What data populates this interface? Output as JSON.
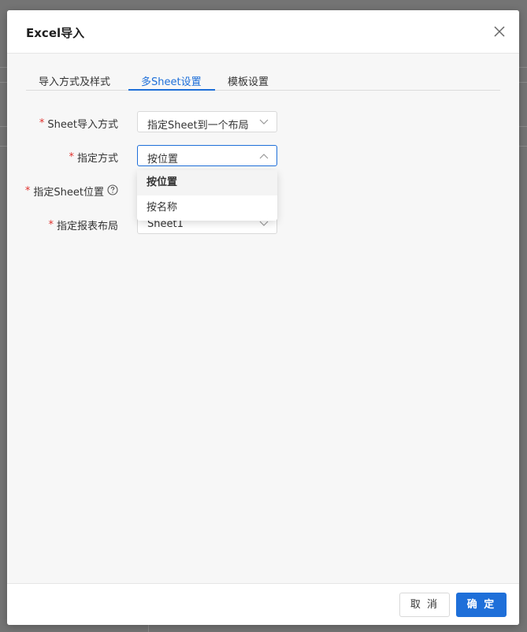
{
  "dialog": {
    "title": "Excel导入",
    "close_icon": "close-icon"
  },
  "tabs": [
    {
      "label": "导入方式及样式",
      "active": false
    },
    {
      "label": "多Sheet设置",
      "active": true
    },
    {
      "label": "模板设置",
      "active": false
    }
  ],
  "form": {
    "required_mark": "*",
    "sheet_import_mode": {
      "label": "Sheet导入方式",
      "value": "指定Sheet到一个布局"
    },
    "specify_mode": {
      "label": "指定方式",
      "value": "按位置"
    },
    "sheet_position": {
      "label": "指定Sheet位置",
      "help_icon": "question-circle-icon"
    },
    "report_layout": {
      "label": "指定报表布局",
      "value": "Sheet1"
    }
  },
  "dropdown": {
    "options": [
      {
        "label": "按位置",
        "selected": true
      },
      {
        "label": "按名称",
        "selected": false
      }
    ]
  },
  "footer": {
    "cancel_label": "取 消",
    "ok_label": "确 定"
  },
  "colors": {
    "accent": "#1e6fd9",
    "required": "#e0312d",
    "dialog_bg": "#f7f7f7"
  }
}
